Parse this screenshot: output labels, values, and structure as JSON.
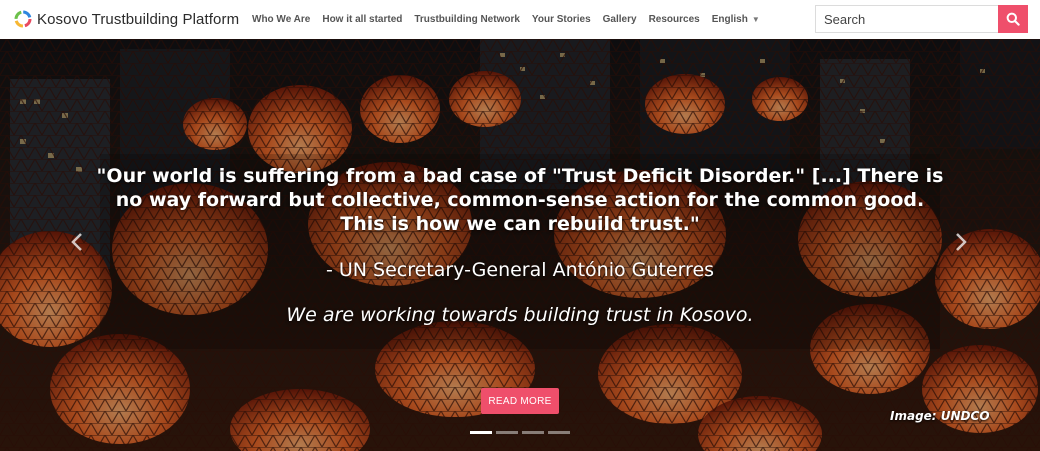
{
  "brand": {
    "name": "Kosovo Trustbuilding Platform",
    "logo_icon": "ring-logo-icon"
  },
  "nav": {
    "items": [
      {
        "label": "Who We Are"
      },
      {
        "label": "How it all started"
      },
      {
        "label": "Trustbuilding Network"
      },
      {
        "label": "Your Stories"
      },
      {
        "label": "Gallery"
      },
      {
        "label": "Resources"
      },
      {
        "label": "English"
      }
    ]
  },
  "search": {
    "placeholder": "Search",
    "button_icon": "search-icon",
    "accent": "#ef4f6b"
  },
  "hero": {
    "quote": "\"Our world is suffering from a bad case of \"Trust Deficit Disorder.\" [...] There is no way forward but collective, common-sense action for the common good. This is how we can rebuild trust.\"",
    "attribution": "- UN Secretary-General António Guterres",
    "tagline": "We are working towards building trust in Kosovo.",
    "button_label": "READ MORE",
    "image_credit": "Image: UNDCO",
    "slide_count": 4,
    "active_slide": 1
  }
}
